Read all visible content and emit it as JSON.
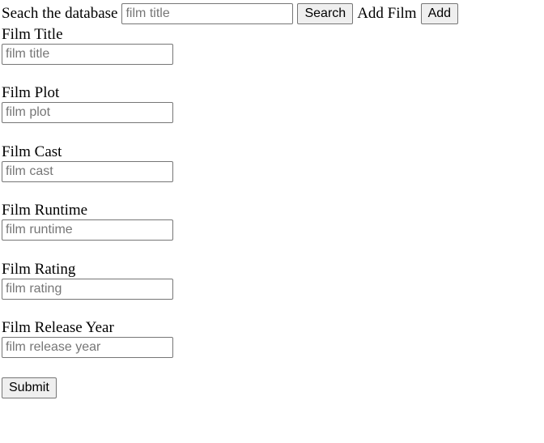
{
  "search": {
    "label": "Seach the database",
    "placeholder": "film title",
    "button": "Search"
  },
  "add": {
    "label": "Add Film",
    "button": "Add"
  },
  "form": {
    "fields": [
      {
        "label": "Film Title",
        "placeholder": "film title"
      },
      {
        "label": "Film Plot",
        "placeholder": "film plot"
      },
      {
        "label": "Film Cast",
        "placeholder": "film cast"
      },
      {
        "label": "Film Runtime",
        "placeholder": "film runtime"
      },
      {
        "label": "Film Rating",
        "placeholder": "film rating"
      },
      {
        "label": "Film Release Year",
        "placeholder": "film release year"
      }
    ],
    "submit": "Submit"
  }
}
